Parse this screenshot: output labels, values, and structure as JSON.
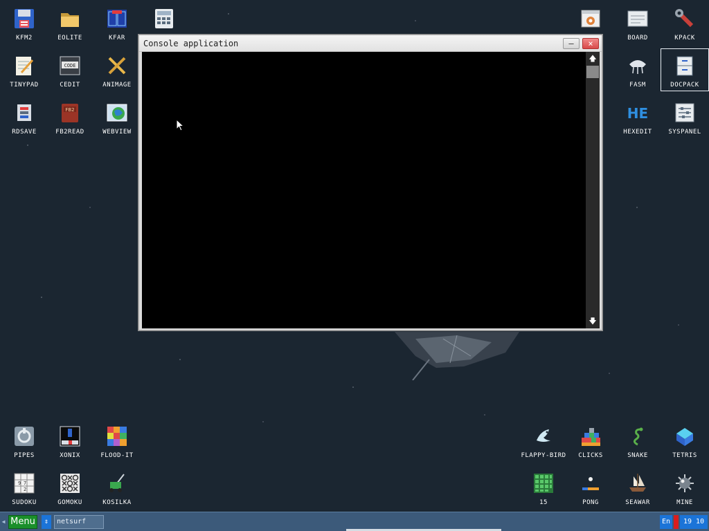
{
  "window": {
    "title": "Console application",
    "minimize_glyph": "–",
    "close_glyph": "×",
    "scroll_up_glyph": "🡅",
    "scroll_down_glyph": "🡇"
  },
  "desktop_icons_left": [
    {
      "id": "kfm2",
      "label": "KFM2",
      "icon": "floppy-disk-icon"
    },
    {
      "id": "eolite",
      "label": "EOLITE",
      "icon": "folder-icon"
    },
    {
      "id": "kfar",
      "label": "KFAR",
      "icon": "dual-panel-icon"
    },
    {
      "id": "calc",
      "label": "",
      "icon": "calculator-icon"
    },
    {
      "id": "tinypad",
      "label": "TINYPAD",
      "icon": "notepad-icon"
    },
    {
      "id": "cedit",
      "label": "CEDIT",
      "icon": "code-editor-icon"
    },
    {
      "id": "animage",
      "label": "ANIMAGE",
      "icon": "pencil-ruler-icon"
    },
    {
      "id": "rdsave",
      "label": "RDSAVE",
      "icon": "rdsave-icon"
    },
    {
      "id": "fb2read",
      "label": "FB2READ",
      "icon": "book-icon"
    },
    {
      "id": "webview",
      "label": "WEBVIEW",
      "icon": "globe-window-icon"
    },
    {
      "id": "pipes",
      "label": "PIPES",
      "icon": "pipes-icon"
    },
    {
      "id": "xonix",
      "label": "XONIX",
      "icon": "xonix-icon"
    },
    {
      "id": "flood-it",
      "label": "FLOOD-IT",
      "icon": "color-grid-icon"
    },
    {
      "id": "sudoku",
      "label": "SUDOKU",
      "icon": "sudoku-grid-icon"
    },
    {
      "id": "gomoku",
      "label": "GOMOKU",
      "icon": "tic-tac-toe-icon"
    },
    {
      "id": "kosilka",
      "label": "KOSILKA",
      "icon": "lawnmower-icon"
    }
  ],
  "desktop_icons_right": [
    {
      "id": "debug",
      "label": "",
      "icon": "bug-window-icon"
    },
    {
      "id": "board",
      "label": "BOARD",
      "icon": "board-icon"
    },
    {
      "id": "kpack",
      "label": "KPACK",
      "icon": "wrench-icon"
    },
    {
      "id": "fasm",
      "label": "FASM",
      "icon": "fasm-icon"
    },
    {
      "id": "docpack",
      "label": "DOCPACK",
      "icon": "file-cabinet-icon"
    },
    {
      "id": "hexedit",
      "label": "HEXEDIT",
      "icon": "he-logo-icon"
    },
    {
      "id": "syspanel",
      "label": "SYSPANEL",
      "icon": "sliders-icon"
    },
    {
      "id": "flappy-bird",
      "label": "FLAPPY-BIRD",
      "icon": "bird-icon"
    },
    {
      "id": "clicks",
      "label": "CLICKS",
      "icon": "blocks-icon"
    },
    {
      "id": "snake",
      "label": "SNAKE",
      "icon": "snake-icon"
    },
    {
      "id": "tetris",
      "label": "TETRIS",
      "icon": "tetris-icon"
    },
    {
      "id": "fifteen",
      "label": "15",
      "icon": "fifteen-puzzle-icon"
    },
    {
      "id": "pong",
      "label": "PONG",
      "icon": "pong-icon"
    },
    {
      "id": "seawar",
      "label": "SEAWAR",
      "icon": "ship-icon"
    },
    {
      "id": "mine",
      "label": "MINE",
      "icon": "mine-icon"
    }
  ],
  "taskbar": {
    "menu_label": "Menu",
    "switch_glyph": "⇕",
    "task_label": "netsurf",
    "lang": "En",
    "clock": "19 10"
  },
  "colors": {
    "desktop_bg": "#1b2631",
    "taskbar_bg": "#3c5a7a",
    "menu_green": "#1a8f2a",
    "accent_blue": "#1b74d8",
    "console_bg": "#000000"
  }
}
